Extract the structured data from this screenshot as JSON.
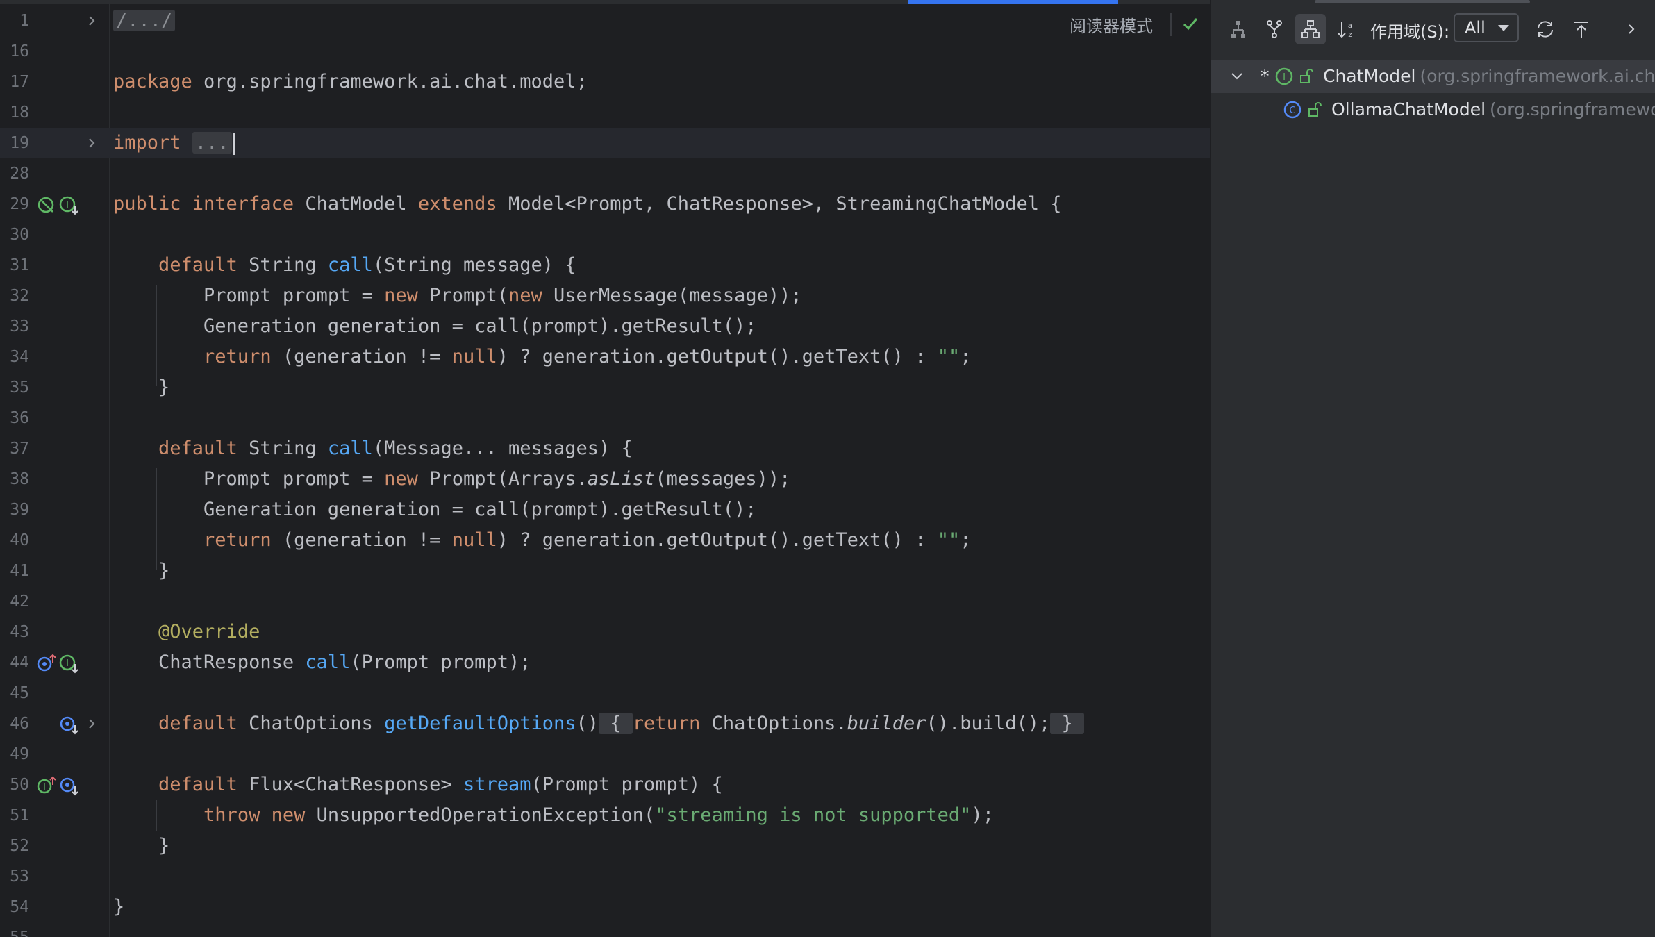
{
  "editor": {
    "reader_mode_label": "阅读器模式",
    "lines": [
      {
        "n": "1",
        "text": "/.../"
      },
      {
        "n": "16",
        "text": ""
      },
      {
        "n": "17",
        "text": "package org.springframework.ai.chat.model;"
      },
      {
        "n": "18",
        "text": ""
      },
      {
        "n": "19",
        "text": "import ..."
      },
      {
        "n": "28",
        "text": ""
      },
      {
        "n": "29",
        "text": "public interface ChatModel extends Model<Prompt, ChatResponse>, StreamingChatModel {"
      },
      {
        "n": "30",
        "text": ""
      },
      {
        "n": "31",
        "text": "default String call(String message) {"
      },
      {
        "n": "32",
        "text": "Prompt prompt = new Prompt(new UserMessage(message));"
      },
      {
        "n": "33",
        "text": "Generation generation = call(prompt).getResult();"
      },
      {
        "n": "34",
        "text": "return (generation != null) ? generation.getOutput().getText() : \"\";"
      },
      {
        "n": "35",
        "text": "}"
      },
      {
        "n": "36",
        "text": ""
      },
      {
        "n": "37",
        "text": "default String call(Message... messages) {"
      },
      {
        "n": "38",
        "text": "Prompt prompt = new Prompt(Arrays.asList(messages));"
      },
      {
        "n": "39",
        "text": "Generation generation = call(prompt).getResult();"
      },
      {
        "n": "40",
        "text": "return (generation != null) ? generation.getOutput().getText() : \"\";"
      },
      {
        "n": "41",
        "text": "}"
      },
      {
        "n": "42",
        "text": ""
      },
      {
        "n": "43",
        "text": "@Override"
      },
      {
        "n": "44",
        "text": "ChatResponse call(Prompt prompt);"
      },
      {
        "n": "45",
        "text": ""
      },
      {
        "n": "46",
        "text": "default ChatOptions getDefaultOptions() { return ChatOptions.builder().build(); }"
      },
      {
        "n": "49",
        "text": ""
      },
      {
        "n": "50",
        "text": "default Flux<ChatResponse> stream(Prompt prompt) {"
      },
      {
        "n": "51",
        "text": "throw new UnsupportedOperationException(\"streaming is not supported\");"
      },
      {
        "n": "52",
        "text": "}"
      },
      {
        "n": "53",
        "text": ""
      },
      {
        "n": "54",
        "text": "}"
      },
      {
        "n": "55",
        "text": ""
      }
    ]
  },
  "hierarchy_panel": {
    "toolbar": {
      "buttons": [
        "supertypes-icon",
        "subtypes-icon",
        "type-hierarchy-icon",
        "sort-alpha-icon",
        "refresh-icon",
        "export-icon",
        "chevron-right-icon"
      ],
      "scope_label": "作用域(S):",
      "scope_value": "All"
    },
    "tree": [
      {
        "marker": "*",
        "name": "ChatModel",
        "package": "(org.springframework.ai.chat.model)",
        "kind": "interface"
      },
      {
        "name": "OllamaChatModel",
        "package": "(org.springframework.ai.ollama)",
        "kind": "class"
      }
    ]
  },
  "colors": {
    "background": "#1e1f22",
    "panel": "#2b2d30",
    "keyword": "#cf8e6d",
    "function": "#56a8f5",
    "string": "#6aab73",
    "annotation": "#b3ae60",
    "accent": "#3574f0"
  }
}
